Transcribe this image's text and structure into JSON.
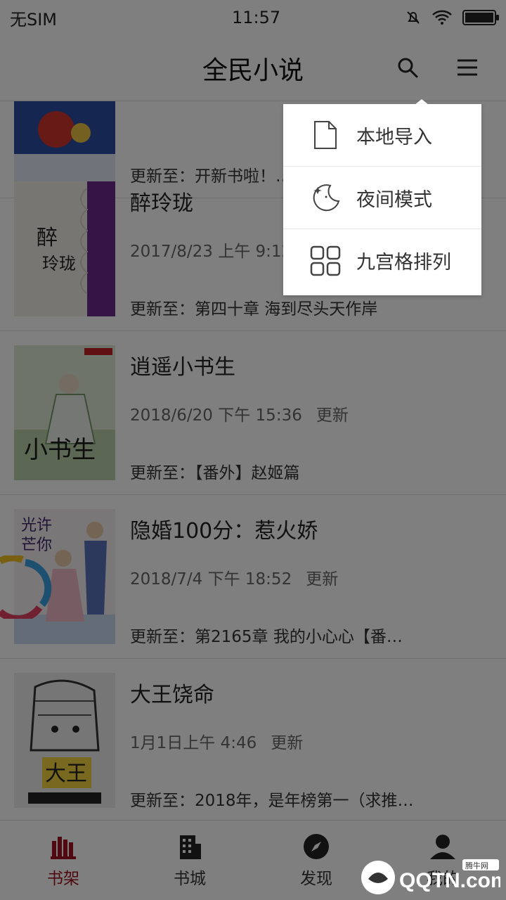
{
  "status_bar": {
    "carrier": "无SIM",
    "time": "11:57"
  },
  "header": {
    "title": "全民小说",
    "search_icon": "search-icon",
    "menu_icon": "hamburger-menu-icon"
  },
  "books": [
    {
      "title": "",
      "date": "",
      "update_label": "",
      "latest": "更新至：开新书啦！…"
    },
    {
      "title": "醉玲珑",
      "date": "2017/8/23 上午 9:12",
      "update_label": "",
      "latest": "更新至：第四十章 海到尽头天作岸"
    },
    {
      "title": "逍遥小书生",
      "date": "2018/6/20 下午 15:36",
      "update_label": "更新",
      "latest": "更新至：【番外】赵姬篇"
    },
    {
      "title": "隐婚100分：惹火娇",
      "date": "2018/7/4 下午 18:52",
      "update_label": "更新",
      "latest": "更新至：第2165章 我的小心心【番…"
    },
    {
      "title": "大王饶命",
      "date": "1月1日上午 4:46",
      "update_label": "更新",
      "latest": "更新至：2018年，是年榜第一（求推…"
    }
  ],
  "popup_menu": {
    "items": [
      {
        "label": "本地导入",
        "icon": "file-icon"
      },
      {
        "label": "夜间模式",
        "icon": "moon-stars-icon"
      },
      {
        "label": "九宫格排列",
        "icon": "grid-icon"
      }
    ]
  },
  "tabs": [
    {
      "label": "书架",
      "icon": "bookshelf-icon",
      "active": true
    },
    {
      "label": "书城",
      "icon": "building-icon",
      "active": false
    },
    {
      "label": "发现",
      "icon": "compass-icon",
      "active": false
    },
    {
      "label": "我的",
      "icon": "user-icon",
      "active": false
    }
  ],
  "watermark": {
    "text": "QQTN.com",
    "badge": "腾牛网"
  },
  "colors": {
    "accent": "#a01020",
    "overlay": "rgba(0,0,0,0.5)"
  }
}
